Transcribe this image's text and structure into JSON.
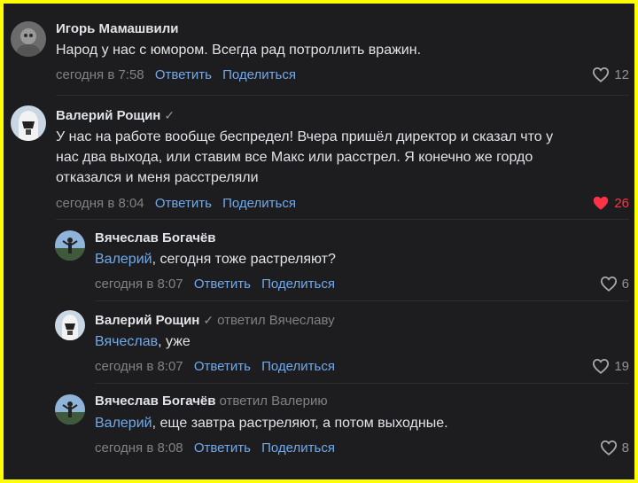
{
  "comments": [
    {
      "author": "Игорь Мамашвили",
      "text": "Народ у нас с юмором. Всегда рад потроллить вражин.",
      "time": "сегодня в 7:58",
      "reply_label": "Ответить",
      "share_label": "Поделиться",
      "likes": "12"
    },
    {
      "author": "Валерий Рощин",
      "verified_mark": "✓",
      "text": "У нас на работе вообще беспредел! Вчера пришёл директор и сказал что у\nнас два выхода, или ставим все Макс или расстрел. Я конечно же гордо\nотказался и меня расстреляли",
      "time": "сегодня в 8:04",
      "reply_label": "Ответить",
      "share_label": "Поделиться",
      "likes": "26",
      "liked": true
    }
  ],
  "replies": [
    {
      "author": "Вячеслав Богачёв",
      "mention": "Валерий",
      "text": ", сегодня тоже растреляют?",
      "time": "сегодня в 8:07",
      "reply_label": "Ответить",
      "share_label": "Поделиться",
      "likes": "6"
    },
    {
      "author": "Валерий Рощин",
      "verified_mark": "✓",
      "replied_to": "ответил Вячеславу",
      "mention": "Вячеслав",
      "text": ", уже",
      "time": "сегодня в 8:07",
      "reply_label": "Ответить",
      "share_label": "Поделиться",
      "likes": "19"
    },
    {
      "author": "Вячеслав Богачёв",
      "replied_to": "ответил Валерию",
      "mention": "Валерий",
      "text": ", еще завтра растреляют, а потом выходные.",
      "time": "сегодня в 8:08",
      "reply_label": "Ответить",
      "share_label": "Поделиться",
      "likes": "8"
    }
  ],
  "colors": {
    "frame_border": "#ffff00",
    "background": "#1d1d1f",
    "link": "#71aaeb",
    "liked_heart": "#ff3347"
  },
  "icons": [
    "heart-outline-icon",
    "heart-filled-icon",
    "verified-check-icon"
  ]
}
